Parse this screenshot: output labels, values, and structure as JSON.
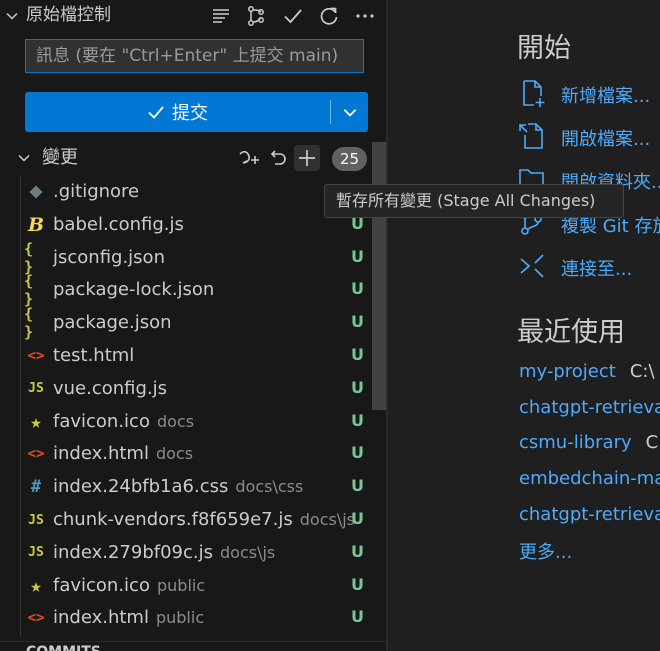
{
  "scm": {
    "title": "原始檔控制",
    "commit_placeholder": "訊息 (要在 \"Ctrl+Enter\" 上提交 main)",
    "commit_button_label": "提交",
    "changes_label": "變更",
    "changes_count": "25",
    "status_color": "#73c991",
    "accent_color": "#0078d4",
    "toolbar_icons": [
      "list-view-icon",
      "branch-graph-icon",
      "check-icon",
      "refresh-icon",
      "more-icon"
    ],
    "files": [
      {
        "name": ".gitignore",
        "dir": "",
        "status": "U",
        "icon": "git-icon"
      },
      {
        "name": "babel.config.js",
        "dir": "",
        "status": "U",
        "icon": "babel-icon"
      },
      {
        "name": "jsconfig.json",
        "dir": "",
        "status": "U",
        "icon": "json-icon"
      },
      {
        "name": "package-lock.json",
        "dir": "",
        "status": "U",
        "icon": "json-icon"
      },
      {
        "name": "package.json",
        "dir": "",
        "status": "U",
        "icon": "json-icon"
      },
      {
        "name": "test.html",
        "dir": "",
        "status": "U",
        "icon": "html-icon"
      },
      {
        "name": "vue.config.js",
        "dir": "",
        "status": "U",
        "icon": "js-icon"
      },
      {
        "name": "favicon.ico",
        "dir": "docs",
        "status": "U",
        "icon": "star-icon"
      },
      {
        "name": "index.html",
        "dir": "docs",
        "status": "U",
        "icon": "html-icon"
      },
      {
        "name": "index.24bfb1a6.css",
        "dir": "docs\\css",
        "status": "U",
        "icon": "css-icon"
      },
      {
        "name": "chunk-vendors.f8f659e7.js",
        "dir": "docs\\js",
        "status": "U",
        "icon": "js-icon"
      },
      {
        "name": "index.279bf09c.js",
        "dir": "docs\\js",
        "status": "U",
        "icon": "js-icon"
      },
      {
        "name": "favicon.ico",
        "dir": "public",
        "status": "U",
        "icon": "star-icon"
      },
      {
        "name": "index.html",
        "dir": "public",
        "status": "U",
        "icon": "html-icon"
      }
    ],
    "commits_label": "COMMITS"
  },
  "tooltip": {
    "text": "暫存所有變更 (Stage All Changes)"
  },
  "welcome": {
    "start_heading": "開始",
    "actions": [
      {
        "label": "新增檔案...",
        "icon": "new-file-icon"
      },
      {
        "label": "開啟檔案...",
        "icon": "open-file-icon"
      },
      {
        "label": "開啟資料夾...",
        "icon": "open-folder-icon"
      },
      {
        "label": "複製 Git 存放庫...",
        "icon": "git-clone-icon"
      },
      {
        "label": "連接至...",
        "icon": "remote-icon"
      }
    ],
    "recent_heading": "最近使用",
    "recent": [
      {
        "name": "my-project",
        "path": "C:\\"
      },
      {
        "name": "chatgpt-retrieval",
        "path": ""
      },
      {
        "name": "csmu-library",
        "path": "C"
      },
      {
        "name": "embedchain-ma",
        "path": ""
      },
      {
        "name": "chatgpt-retrieval",
        "path": ""
      }
    ],
    "more_label": "更多..."
  }
}
